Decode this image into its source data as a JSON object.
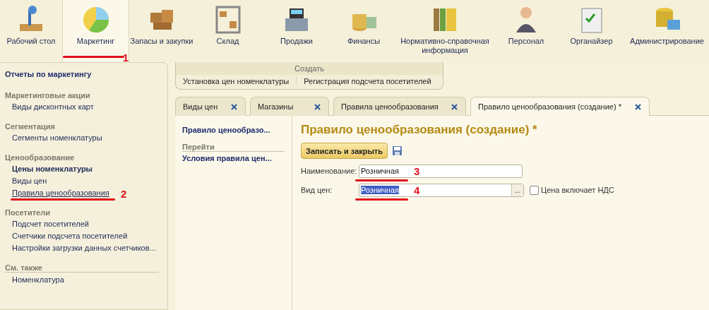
{
  "sections": [
    {
      "label": "Рабочий стол",
      "selected": false
    },
    {
      "label": "Маркетинг",
      "selected": true,
      "annotation": "1"
    },
    {
      "label": "Запасы и закупки",
      "selected": false
    },
    {
      "label": "Склад",
      "selected": false
    },
    {
      "label": "Продажи",
      "selected": false
    },
    {
      "label": "Финансы",
      "selected": false
    },
    {
      "label": "Нормативно-справочная информация",
      "selected": false
    },
    {
      "label": "Персонал",
      "selected": false
    },
    {
      "label": "Органайзер",
      "selected": false
    },
    {
      "label": "Администрирование",
      "selected": false
    }
  ],
  "sidebar": {
    "title": "Отчеты по маркетингу",
    "groups": [
      {
        "heading": "Маркетинговые акции",
        "items": [
          {
            "label": "Виды дисконтных карт",
            "bold": false,
            "selected": false
          }
        ]
      },
      {
        "heading": "Сегментация",
        "items": [
          {
            "label": "Сегменты номенклатуры",
            "bold": false,
            "selected": false
          }
        ]
      },
      {
        "heading": "Ценообразование",
        "items": [
          {
            "label": "Цены номенклатуры",
            "bold": true,
            "selected": false
          },
          {
            "label": "Виды цен",
            "bold": false,
            "selected": false
          },
          {
            "label": "Правила ценообразования",
            "bold": false,
            "selected": true,
            "annotation": "2"
          }
        ]
      },
      {
        "heading": "Посетители",
        "items": [
          {
            "label": "Подсчет посетителей",
            "bold": false,
            "selected": false
          },
          {
            "label": "Счетчики подсчета посетителей",
            "bold": false,
            "selected": false
          },
          {
            "label": "Настройки загрузки данных счетчиков...",
            "bold": false,
            "selected": false
          }
        ]
      },
      {
        "heading": "См. также",
        "items": [
          {
            "label": "Номенклатура",
            "bold": false,
            "selected": false
          }
        ]
      }
    ]
  },
  "create_panel": {
    "title": "Создать",
    "actions": [
      "Установка цен номенклатуры",
      "Регистрация подсчета посетителей"
    ]
  },
  "tabs": [
    {
      "label": "Виды цен",
      "selected": false
    },
    {
      "label": "Магазины",
      "selected": false
    },
    {
      "label": "Правила ценообразования",
      "selected": false
    },
    {
      "label": "Правило ценообразования (создание) *",
      "selected": true
    }
  ],
  "form_nav": {
    "title": "Правило ценообразо...",
    "heading": "Перейти",
    "links": [
      "Условия правила цен..."
    ]
  },
  "form": {
    "title": "Правило ценообразования (создание) *",
    "save_button": "Записать и закрыть",
    "fields": [
      {
        "label": "Наименование:",
        "value": "Розничная",
        "kind": "text",
        "highlighted": false,
        "annotation": "3"
      },
      {
        "label": "Вид цен:",
        "value": "Розничная",
        "kind": "choice",
        "highlighted": true,
        "annotation": "4",
        "choice_button": "...",
        "checkbox": {
          "label": "Цена включает НДС",
          "checked": false
        }
      }
    ]
  }
}
